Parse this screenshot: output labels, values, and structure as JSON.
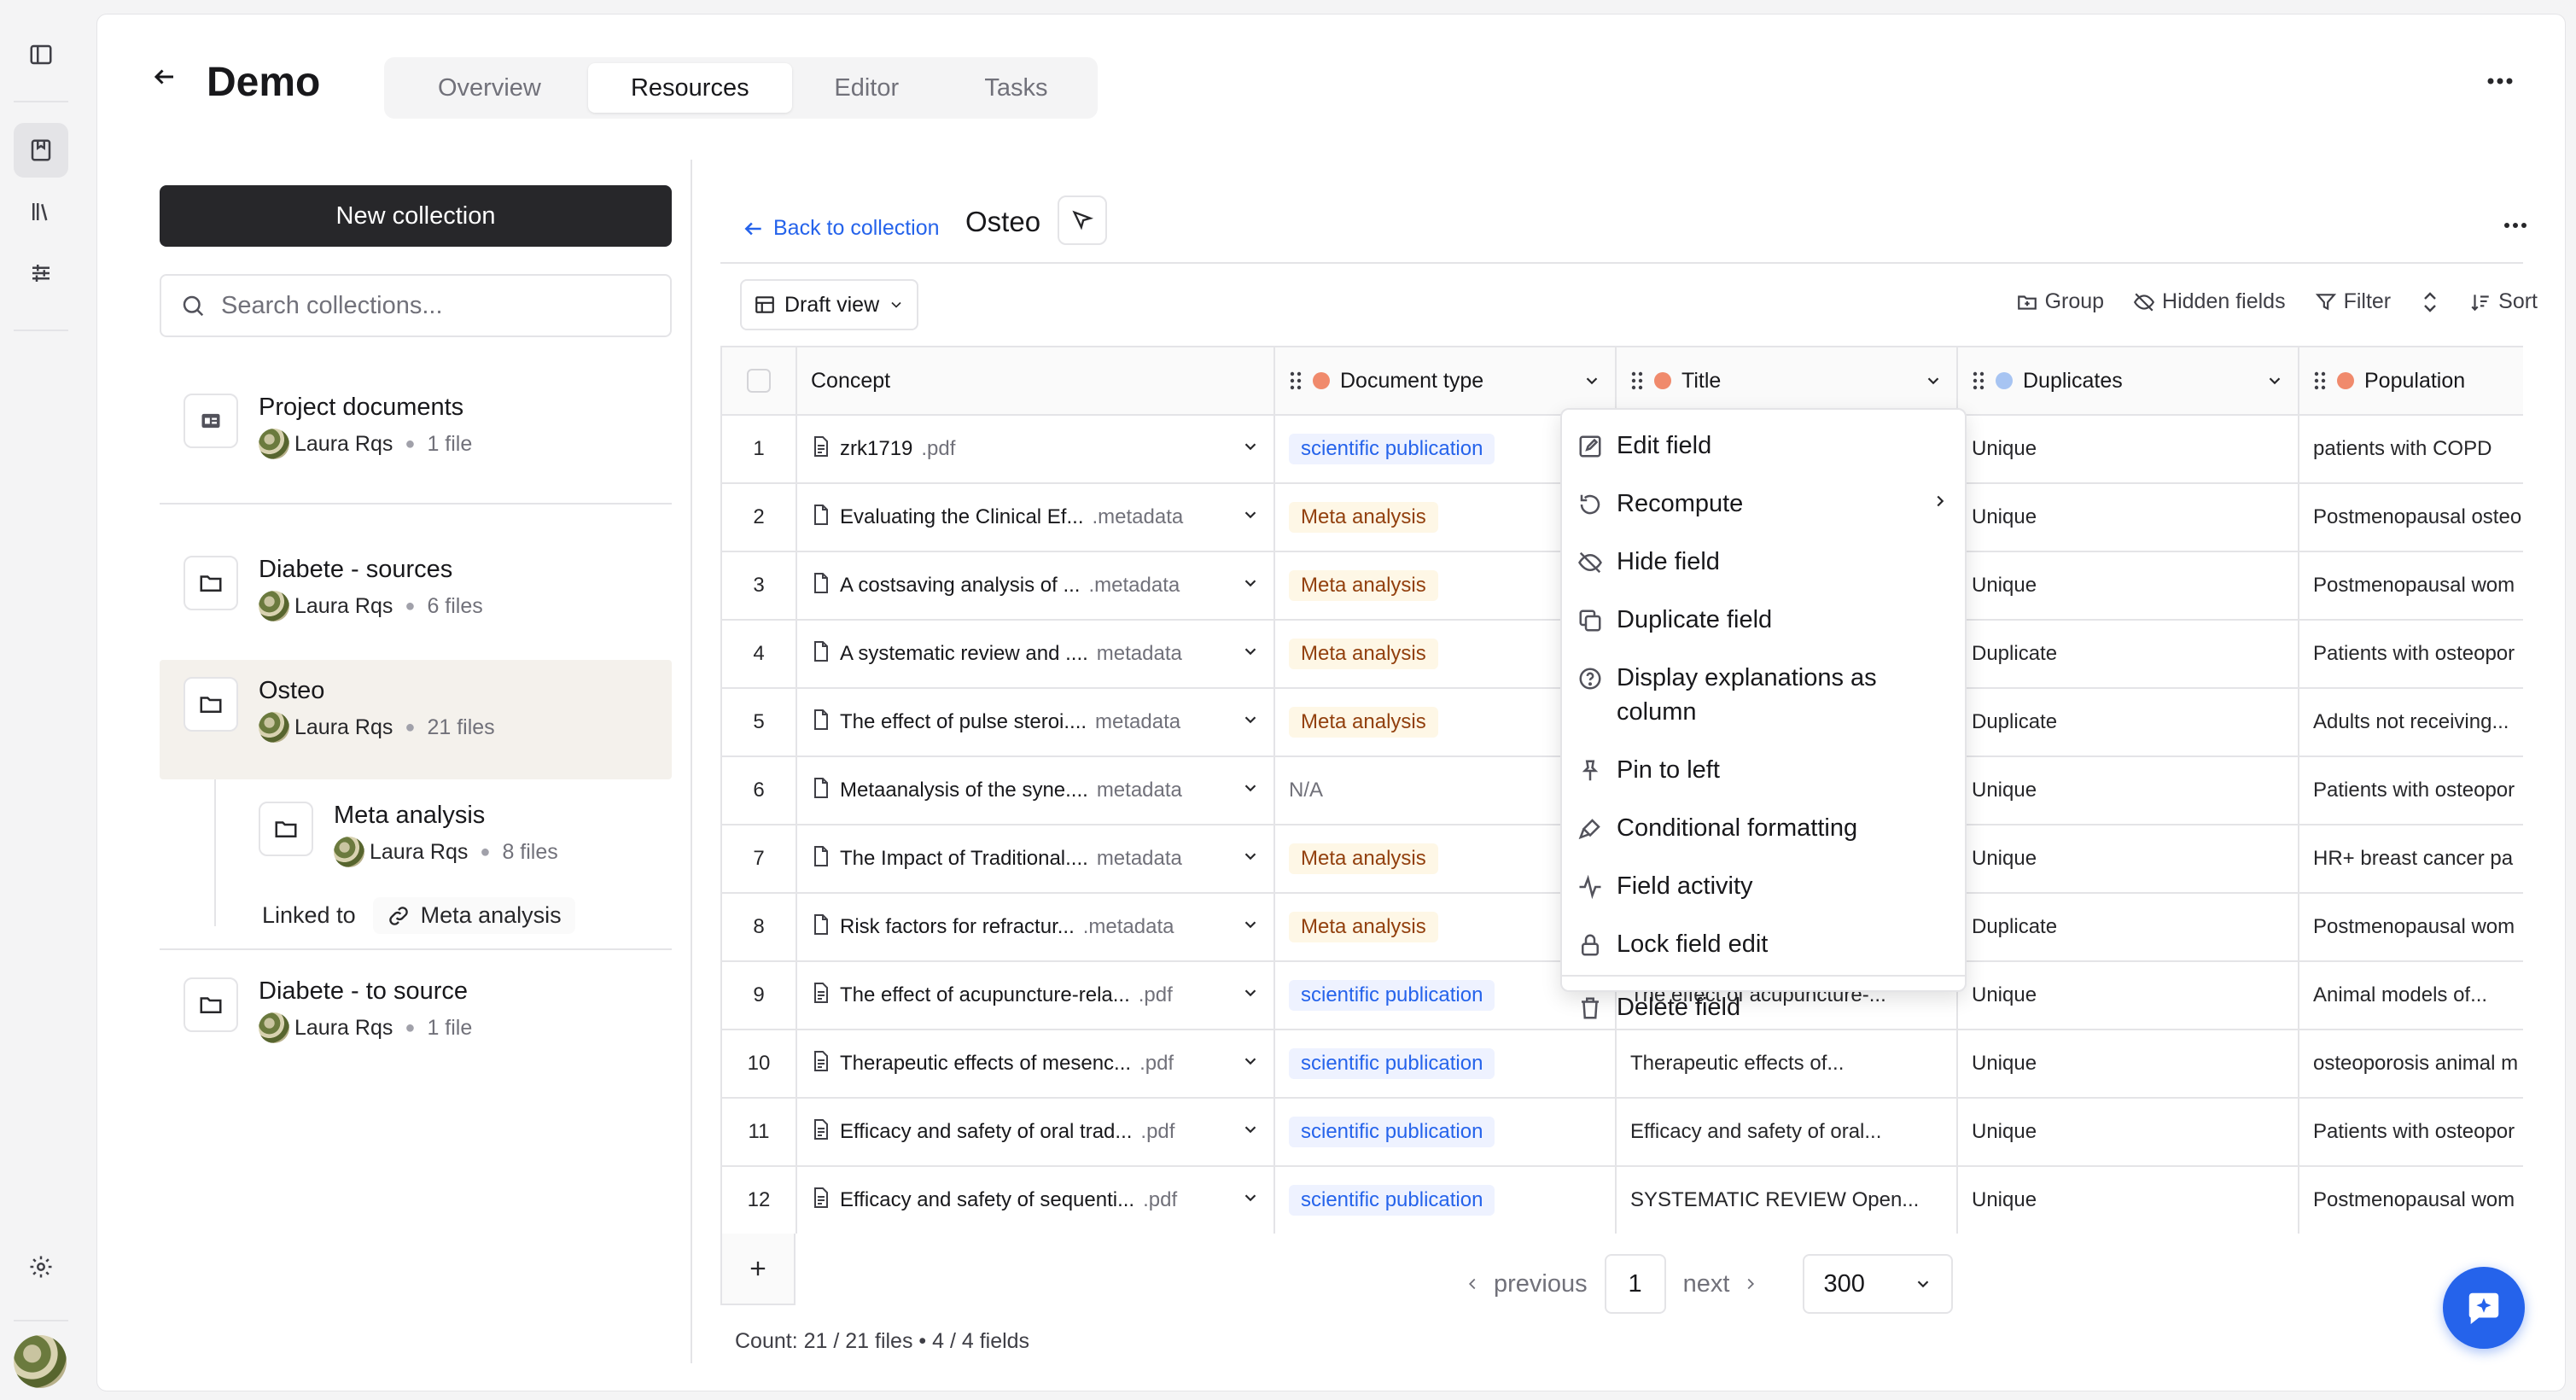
{
  "app": {
    "title": "Demo",
    "tabs": [
      {
        "label": "Overview"
      },
      {
        "label": "Resources",
        "active": true
      },
      {
        "label": "Editor"
      },
      {
        "label": "Tasks"
      }
    ]
  },
  "sidebar": {
    "new_collection_label": "New collection",
    "search_placeholder": "Search collections...",
    "collections": [
      {
        "name": "Project documents",
        "owner": "Laura Rqs",
        "files": "1 file"
      },
      {
        "name": "Diabete - sources",
        "owner": "Laura Rqs",
        "files": "6 files"
      },
      {
        "name": "Osteo",
        "owner": "Laura Rqs",
        "files": "21 files",
        "selected": true
      },
      {
        "name": "Meta analysis",
        "owner": "Laura Rqs",
        "files": "8 files"
      },
      {
        "name": "Diabete - to source",
        "owner": "Laura Rqs",
        "files": "1 file"
      }
    ],
    "linked_label": "Linked to",
    "linked_collection": "Meta analysis"
  },
  "collection": {
    "back_label": "Back to collection",
    "title": "Osteo",
    "view_label": "Draft view",
    "toolbar": {
      "group": "Group",
      "hidden_fields": "Hidden fields",
      "filter": "Filter",
      "sort": "Sort"
    }
  },
  "table": {
    "columns": [
      {
        "label": "Concept"
      },
      {
        "label": "Document type",
        "color": "#f08a6c"
      },
      {
        "label": "Title",
        "color": "#f08a6c"
      },
      {
        "label": "Duplicates",
        "color": "#a7c4f2"
      },
      {
        "label": "Population",
        "color": "#f08a6c"
      }
    ],
    "rows": [
      {
        "n": "1",
        "name": "zrk1719",
        "ext": ".pdf",
        "icon": "pdf",
        "type": "scientific publication",
        "kind": "sci",
        "title": "",
        "dup": "Unique",
        "pop": "patients with COPD"
      },
      {
        "n": "2",
        "name": "Evaluating the Clinical Ef...",
        "ext": ".metadata",
        "icon": "meta",
        "type": "Meta analysis",
        "kind": "meta",
        "title": "",
        "dup": "Unique",
        "pop": "Postmenopausal osteo"
      },
      {
        "n": "3",
        "name": "A costsaving analysis of ...",
        "ext": ".metadata",
        "icon": "meta",
        "type": "Meta analysis",
        "kind": "meta",
        "title": "",
        "dup": "Unique",
        "pop": "Postmenopausal wom"
      },
      {
        "n": "4",
        "name": "A systematic review and ....",
        "ext": "metadata",
        "icon": "meta",
        "type": "Meta analysis",
        "kind": "meta",
        "title": "",
        "dup": "Duplicate",
        "pop": "Patients with osteopor"
      },
      {
        "n": "5",
        "name": "The effect of pulse steroi....",
        "ext": "metadata",
        "icon": "meta",
        "type": "Meta analysis",
        "kind": "meta",
        "title": "",
        "dup": "Duplicate",
        "pop": "Adults not receiving..."
      },
      {
        "n": "6",
        "name": "Metaanalysis of the syne....",
        "ext": "metadata",
        "icon": "meta",
        "type": "N/A",
        "kind": "na",
        "title": "",
        "dup": "Unique",
        "pop": "Patients with osteopor"
      },
      {
        "n": "7",
        "name": "The Impact of Traditional....",
        "ext": "metadata",
        "icon": "meta",
        "type": "Meta analysis",
        "kind": "meta",
        "title": "",
        "dup": "Unique",
        "pop": "HR+ breast cancer pa"
      },
      {
        "n": "8",
        "name": "Risk factors for refractur...",
        "ext": ".metadata",
        "icon": "meta",
        "type": "Meta analysis",
        "kind": "meta",
        "title": "",
        "dup": "Duplicate",
        "pop": "Postmenopausal wom"
      },
      {
        "n": "9",
        "name": "The effect of acupuncture-rela...",
        "ext": ".pdf",
        "icon": "pdf",
        "type": "scientific publication",
        "kind": "sci",
        "title": "The effect of acupuncture-...",
        "dup": "Unique",
        "pop": "Animal models of..."
      },
      {
        "n": "10",
        "name": "Therapeutic effects of mesenc...",
        "ext": ".pdf",
        "icon": "pdf",
        "type": "scientific publication",
        "kind": "sci",
        "title": "Therapeutic effects of...",
        "dup": "Unique",
        "pop": "osteoporosis animal m"
      },
      {
        "n": "11",
        "name": "Efficacy and safety of oral trad...",
        "ext": ".pdf",
        "icon": "pdf",
        "type": "scientific publication",
        "kind": "sci",
        "title": "Efficacy and safety of oral...",
        "dup": "Unique",
        "pop": "Patients with osteopor"
      },
      {
        "n": "12",
        "name": "Efficacy and safety of sequenti...",
        "ext": ".pdf",
        "icon": "pdf",
        "type": "scientific publication",
        "kind": "sci",
        "title": "SYSTEMATIC REVIEW Open...",
        "dup": "Unique",
        "pop": "Postmenopausal wom"
      }
    ]
  },
  "context_menu": {
    "items": [
      {
        "label": "Edit field",
        "icon": "pencil-icon"
      },
      {
        "label": "Recompute",
        "icon": "recompute-icon",
        "submenu": true
      },
      {
        "label": "Hide field",
        "icon": "eye-off-icon"
      },
      {
        "label": "Duplicate field",
        "icon": "copy-icon"
      },
      {
        "label": "Display explanations as column",
        "icon": "help-circle-icon"
      },
      {
        "label": "Pin to left",
        "icon": "pin-icon"
      },
      {
        "label": "Conditional formatting",
        "icon": "paint-icon"
      },
      {
        "label": "Field activity",
        "icon": "activity-icon"
      },
      {
        "label": "Lock field edit",
        "icon": "lock-icon"
      },
      {
        "label": "Delete field",
        "icon": "trash-icon"
      }
    ]
  },
  "pagination": {
    "previous": "previous",
    "page": "1",
    "next": "next",
    "page_size": "300"
  },
  "footer": {
    "count": "Count: 21 / 21 files • 4 / 4 fields"
  },
  "colors": {
    "accent": "#2563eb",
    "primary_button": "#27272a",
    "selected_row": "#f4f1ec"
  }
}
